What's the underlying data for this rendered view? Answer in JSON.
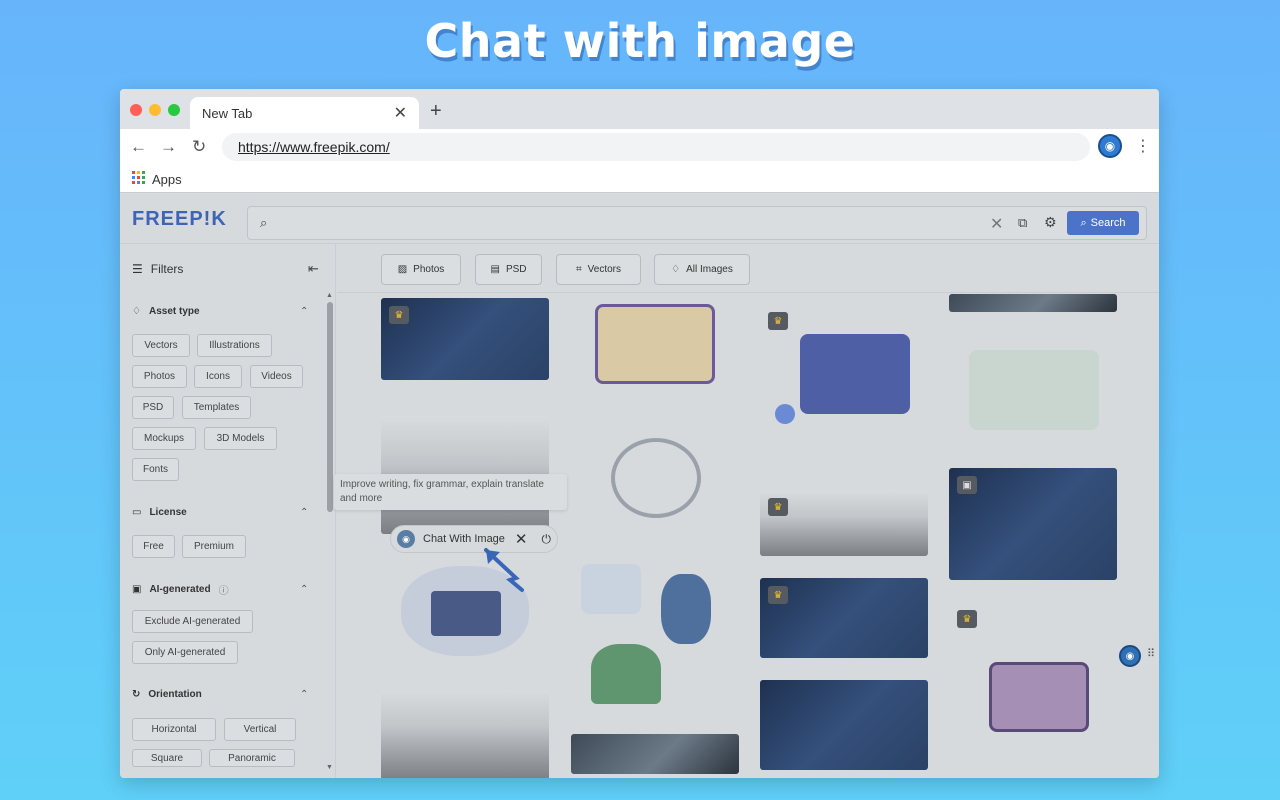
{
  "hero": {
    "title": "Chat with image"
  },
  "browser": {
    "tab_title": "New Tab",
    "url": "https://www.freepik.com/",
    "bookmarks": {
      "apps_label": "Apps"
    }
  },
  "site": {
    "logo": "FREEP!K",
    "search": {
      "placeholder": "",
      "button_label": "Search"
    },
    "filters": {
      "title": "Filters",
      "sections": {
        "asset_type": {
          "title": "Asset type",
          "chips": [
            "Vectors",
            "Illustrations",
            "Photos",
            "Icons",
            "Videos",
            "PSD",
            "Templates",
            "Mockups",
            "3D Models",
            "Fonts"
          ]
        },
        "license": {
          "title": "License",
          "chips": [
            "Free",
            "Premium"
          ]
        },
        "ai_generated": {
          "title": "AI-generated",
          "chips": [
            "Exclude AI-generated",
            "Only AI-generated"
          ]
        },
        "orientation": {
          "title": "Orientation",
          "chips": [
            "Horizontal",
            "Vertical",
            "Square",
            "Panoramic"
          ]
        }
      }
    },
    "type_tabs": [
      "Photos",
      "PSD",
      "Vectors",
      "All Images"
    ],
    "extension": {
      "tooltip": "Improve writing, fix grammar, explain translate and more",
      "chat_label": "Chat With Image"
    }
  },
  "icons": {
    "search": "search-icon",
    "gear": "gear-icon",
    "crown": "crown-icon",
    "robot": "robot-icon"
  },
  "colors": {
    "background_top": "#67b4fb",
    "background_bottom": "#5fd0f8",
    "brand_blue": "#3d64b7",
    "search_button": "#4b73c9"
  }
}
